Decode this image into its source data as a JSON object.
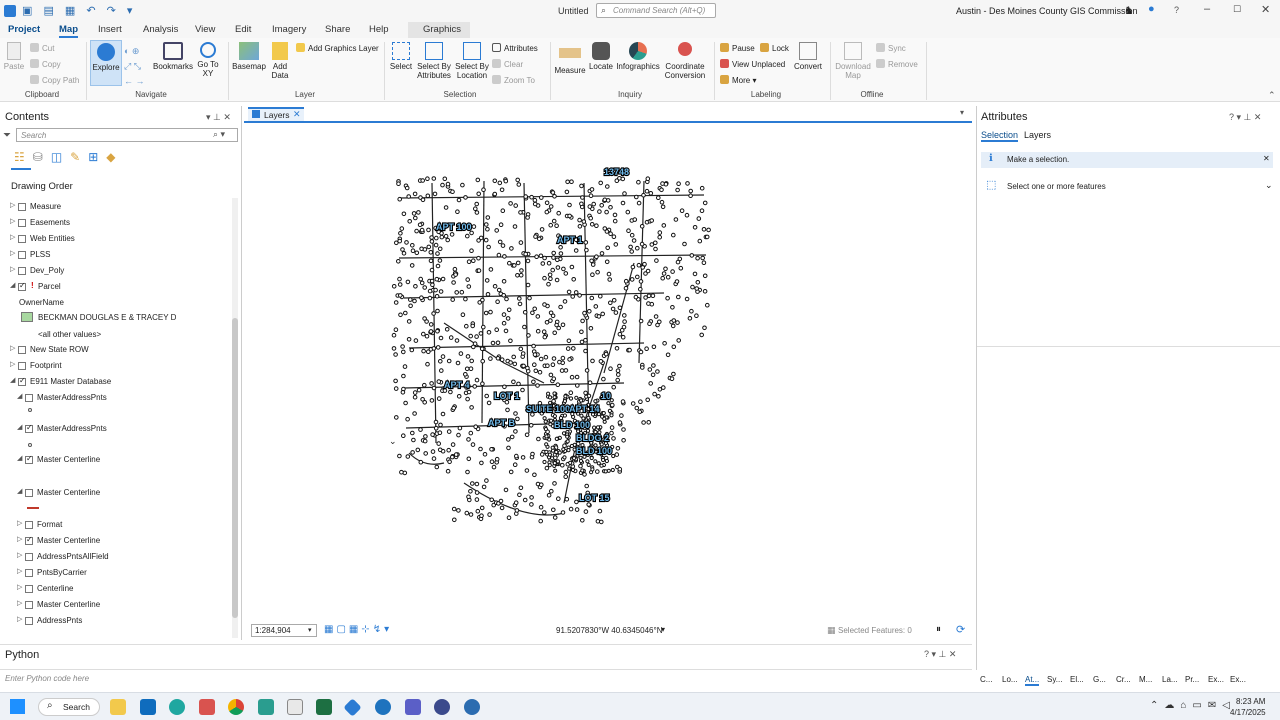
{
  "titlebar": {
    "doc_title": "Untitled",
    "search_placeholder": "Command Search (Alt+Q)",
    "org": "Austin - Des Moines County GIS Commission"
  },
  "ribbon": {
    "tabs": [
      "Project",
      "Map",
      "Insert",
      "Analysis",
      "View",
      "Edit",
      "Imagery",
      "Share",
      "Help",
      "Graphics"
    ],
    "active_tab": "Map",
    "groups": {
      "clipboard": {
        "label": "Clipboard",
        "paste": "Paste",
        "cut": "Cut",
        "copy": "Copy",
        "copy_path": "Copy Path"
      },
      "navigate": {
        "label": "Navigate",
        "explore": "Explore",
        "bookmarks": "Bookmarks",
        "goto_xy": "Go To XY"
      },
      "layer": {
        "label": "Layer",
        "basemap": "Basemap",
        "add_data": "Add Data",
        "add_graphics": "Add Graphics Layer"
      },
      "selection": {
        "label": "Selection",
        "select": "Select",
        "by_attr": "Select By Attributes",
        "by_loc": "Select By Location",
        "attributes": "Attributes",
        "clear": "Clear",
        "zoom_to": "Zoom To"
      },
      "inquiry": {
        "label": "Inquiry",
        "measure": "Measure",
        "locate": "Locate",
        "infographics": "Infographics",
        "coord_conv": "Coordinate Conversion"
      },
      "labeling": {
        "label": "Labeling",
        "pause": "Pause",
        "lock": "Lock",
        "view_unplaced": "View Unplaced",
        "more": "More",
        "convert": "Convert"
      },
      "offline": {
        "label": "Offline",
        "download": "Download Map",
        "sync": "Sync",
        "remove": "Remove"
      }
    }
  },
  "contents": {
    "title": "Contents",
    "search_placeholder": "Search",
    "drawing_order": "Drawing Order",
    "items": [
      {
        "label": "Measure",
        "checked": false,
        "indent": 0
      },
      {
        "label": "Easements",
        "checked": false,
        "indent": 0
      },
      {
        "label": "Web Entities",
        "checked": false,
        "indent": 0
      },
      {
        "label": "PLSS",
        "checked": false,
        "indent": 0
      },
      {
        "label": "Dev_Poly",
        "checked": false,
        "indent": 0
      },
      {
        "label": "Parcel",
        "checked": true,
        "indent": 0
      },
      {
        "label": "New State ROW",
        "checked": false,
        "indent": 0
      },
      {
        "label": "Footprint",
        "checked": false,
        "indent": 0
      },
      {
        "label": "E911 Master Database",
        "checked": true,
        "indent": 0
      },
      {
        "label": "MasterAddressPnts",
        "checked": false,
        "indent": 1
      },
      {
        "label": "MasterAddressPnts",
        "checked": true,
        "indent": 1
      },
      {
        "label": "Master Centerline",
        "checked": true,
        "indent": 1
      },
      {
        "label": "Master Centerline",
        "checked": false,
        "indent": 1
      },
      {
        "label": "Format",
        "checked": false,
        "indent": 1
      },
      {
        "label": "Master Centerline",
        "checked": true,
        "indent": 1
      },
      {
        "label": "AddressPntsAllField",
        "checked": false,
        "indent": 1
      },
      {
        "label": "PntsByCarrier",
        "checked": false,
        "indent": 1
      },
      {
        "label": "Centerline",
        "checked": false,
        "indent": 1
      },
      {
        "label": "Master Centerline",
        "checked": false,
        "indent": 1
      },
      {
        "label": "AddressPnts",
        "checked": false,
        "indent": 1
      }
    ],
    "parcel_legend": {
      "field": "OwnerName",
      "value": "BECKMAN DOUGLAS E & TRACEY D",
      "other": "<all other values>"
    }
  },
  "map": {
    "tab_label": "Layers",
    "labels": [
      "13748",
      "APT 100",
      "APT 1",
      "APT 4",
      "LOT 1",
      "SUITE 100",
      "APT 14",
      "APT B",
      "BLD 100",
      "BLDG 2",
      "BLD 100",
      "LOT 15",
      "10"
    ],
    "scale": "1:284,904",
    "coords": "91.5207830°W 40.6345046°N",
    "selected_features": "Selected Features: 0"
  },
  "attributes": {
    "title": "Attributes",
    "tab_selection": "Selection",
    "tab_layers": "Layers",
    "info": "Make a selection.",
    "select_features": "Select one or more features",
    "bottom_tabs": [
      "C...",
      "Lo...",
      "At...",
      "Sy...",
      "El...",
      "G...",
      "Cr...",
      "M...",
      "La...",
      "Pr...",
      "Ex...",
      "Ex..."
    ]
  },
  "python": {
    "title": "Python",
    "placeholder": "Enter Python code here"
  },
  "taskbar": {
    "search": "Search",
    "time": "8:23 AM",
    "date": "4/17/2025"
  },
  "colors": {
    "accent": "#2b7bd3",
    "legend_fill": "#a8d8a0",
    "label_fill": "#6fb8e8"
  }
}
